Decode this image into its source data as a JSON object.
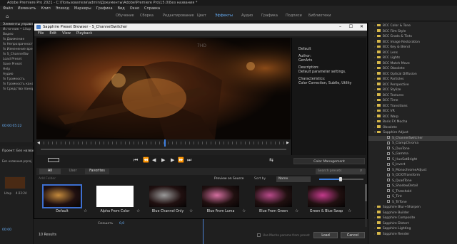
{
  "app": {
    "title": "Adobe Premiere Pro 2021 - C:\\Пользователи\\admin\\Документы\\Adobe\\Premiere Pro\\15.0\\Без названия *",
    "menu": [
      "Файл",
      "Изменить",
      "Клип",
      "Эпизод",
      "Маркеры",
      "Графика",
      "Вид",
      "Окно",
      "Справка"
    ],
    "workspaces": [
      "Обучение",
      "Сборка",
      "Редактирование",
      "Цвет",
      "Эффекты",
      "Аудио",
      "Графика",
      "Подписи",
      "Библиотеки"
    ],
    "active_workspace": "Эффекты",
    "left_panel_items": [
      "Элементы управления эфф",
      "Источник • Litup",
      "Видео",
      "fx Движение",
      "fx Непрозрачность",
      "fx Изменение вре",
      "fx S_ChannelSw",
      "Load Preset",
      "Save Preset",
      "Help",
      "Аудио",
      "fx Громкость",
      "fx Громкость канал",
      "fx Средство панор"
    ],
    "left_bottom": {
      "timecode": "00:00:05:22",
      "project_label": "Проект: Без назван",
      "file_label": "Без названия.prproj",
      "clip_label": "Litup",
      "clip_duration": "4:22:24",
      "timeline_timecode": "00:00"
    },
    "right_panel_items": [
      {
        "label": "BCC Color & Tone",
        "type": "folder"
      },
      {
        "label": "BCC Film Style",
        "type": "folder"
      },
      {
        "label": "BCC Grads & Tints",
        "type": "folder"
      },
      {
        "label": "BCC Image Restoration",
        "type": "folder"
      },
      {
        "label": "BCC Key & Blend",
        "type": "folder"
      },
      {
        "label": "BCC Lens",
        "type": "folder"
      },
      {
        "label": "BCC Lights",
        "type": "folder"
      },
      {
        "label": "BCC Match Move",
        "type": "folder"
      },
      {
        "label": "BCC Obsolete",
        "type": "folder"
      },
      {
        "label": "BCC Optical Diffusion",
        "type": "folder"
      },
      {
        "label": "BCC Particles",
        "type": "folder"
      },
      {
        "label": "BCC Perspective",
        "type": "folder"
      },
      {
        "label": "BCC Stylize",
        "type": "folder"
      },
      {
        "label": "BCC Textures",
        "type": "folder"
      },
      {
        "label": "BCC Time",
        "type": "folder"
      },
      {
        "label": "BCC Transitions",
        "type": "folder"
      },
      {
        "label": "BCC VR",
        "type": "folder"
      },
      {
        "label": "BCC Warp",
        "type": "folder"
      },
      {
        "label": "Boris FX Mocha",
        "type": "folder"
      },
      {
        "label": "Obsolete",
        "type": "folder"
      },
      {
        "label": "Sapphire Adjust",
        "type": "folder",
        "expanded": true
      },
      {
        "label": "S_ChannelSwitcher",
        "type": "effect",
        "selected": true
      },
      {
        "label": "S_ClampChroma",
        "type": "effect"
      },
      {
        "label": "S_DuoTone",
        "type": "effect"
      },
      {
        "label": "S_Gamma",
        "type": "effect"
      },
      {
        "label": "S_HueSatBright",
        "type": "effect"
      },
      {
        "label": "S_Invert",
        "type": "effect"
      },
      {
        "label": "S_MonochromeAdjust",
        "type": "effect"
      },
      {
        "label": "S_OCIOTransform",
        "type": "effect"
      },
      {
        "label": "S_QuadTone",
        "type": "effect"
      },
      {
        "label": "S_ShadowDetail",
        "type": "effect"
      },
      {
        "label": "S_Threshold",
        "type": "effect"
      },
      {
        "label": "S_Tint",
        "type": "effect"
      },
      {
        "label": "S_TriTone",
        "type": "effect"
      },
      {
        "label": "Sapphire Blur+Sharpen",
        "type": "folder"
      },
      {
        "label": "Sapphire Builder",
        "type": "folder"
      },
      {
        "label": "Sapphire Composite",
        "type": "folder"
      },
      {
        "label": "Sapphire Distort",
        "type": "folder"
      },
      {
        "label": "Sapphire Lighting",
        "type": "folder"
      },
      {
        "label": "Sapphire Render",
        "type": "folder"
      }
    ],
    "bottom_strip": {
      "track_label": "Смешать",
      "track_value": "0,0"
    }
  },
  "dialog": {
    "title": "Sapphire Preset Browser - S_ChannelSwitcher",
    "menu": [
      "File",
      "Edit",
      "View",
      "Playback"
    ],
    "video_overlay_text": "7HD",
    "info": {
      "name": "Default",
      "author_label": "Author:",
      "author": "GenArts",
      "description_label": "Description:",
      "description": "Default parameter settings.",
      "characteristics_label": "Characteristics:",
      "characteristics": "Color Correction, Subtle, Utility"
    },
    "color_management": "Color Management",
    "tabs": [
      {
        "label": "All",
        "active": true
      },
      {
        "label": "User",
        "active": false
      },
      {
        "label": "Favorites",
        "active": false
      }
    ],
    "add_folder": "Add Folder",
    "search_placeholder": "Search presets",
    "preview_mode": "Preview on Source",
    "sort_by_label": "Sort by",
    "sort_by": "Name",
    "presets": [
      {
        "label": "Default",
        "tint": "#c48a3c",
        "selected": true
      },
      {
        "label": "Alpha From Color",
        "tint": "#ffffff",
        "selected": false
      },
      {
        "label": "Blue Channel Only",
        "tint": "#9a9a9a",
        "selected": false
      },
      {
        "label": "Blue From Luma",
        "tint": "#d46fa0",
        "selected": false
      },
      {
        "label": "Blue From Green",
        "tint": "#b84a8a",
        "selected": false
      },
      {
        "label": "Green & Blue Swap",
        "tint": "#c43a8c",
        "selected": false
      }
    ],
    "results": "10 Results",
    "mocha_checkbox": "Use Mocha params from preset",
    "load_button": "Load",
    "cancel_button": "Cancel"
  }
}
